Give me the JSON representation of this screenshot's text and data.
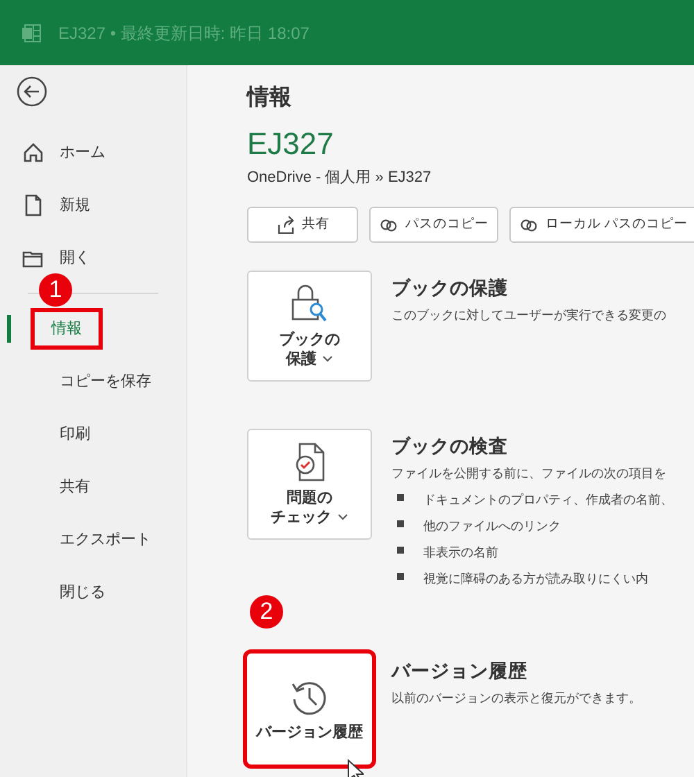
{
  "title_bar": {
    "title": "EJ327 • 最終更新日時: 昨日 18:07"
  },
  "sidebar": {
    "top_items": [
      {
        "label": "ホーム",
        "selected": false,
        "highlighted": false
      },
      {
        "label": "新規",
        "selected": false,
        "highlighted": false
      },
      {
        "label": "開く",
        "selected": false,
        "highlighted": false
      }
    ],
    "items": [
      {
        "label": "情報",
        "selected": true,
        "highlighted": true
      },
      {
        "label": "コピーを保存",
        "selected": false,
        "highlighted": false
      },
      {
        "label": "印刷",
        "selected": false,
        "highlighted": false
      },
      {
        "label": "共有",
        "selected": false,
        "highlighted": false
      },
      {
        "label": "エクスポート",
        "selected": false,
        "highlighted": false
      },
      {
        "label": "閉じる",
        "selected": false,
        "highlighted": false
      }
    ]
  },
  "annotations": [
    {
      "label": "1"
    },
    {
      "label": "2"
    }
  ],
  "page": {
    "heading": "情報",
    "file_name": "EJ327",
    "path": "OneDrive - 個人用 » EJ327",
    "actions": [
      {
        "label": "共有"
      },
      {
        "label": "パスのコピー"
      },
      {
        "label": "ローカル パスのコピー"
      }
    ],
    "sections": [
      {
        "button_lines": [
          "ブックの",
          "保護"
        ],
        "dropdown": true,
        "highlighted": false,
        "title": "ブックの保護",
        "description": "このブックに対してユーザーが実行できる変更の"
      },
      {
        "button_lines": [
          "問題の",
          "チェック"
        ],
        "dropdown": true,
        "highlighted": false,
        "title": "ブックの検査",
        "description": "ファイルを公開する前に、ファイルの次の項目を",
        "bullets": [
          "ドキュメントのプロパティ、作成者の名前、",
          "他のファイルへのリンク",
          "非表示の名前",
          "視覚に障碍のある方が読み取りにくい内"
        ]
      },
      {
        "button_lines": [
          "バージョン履歴"
        ],
        "dropdown": false,
        "highlighted": true,
        "title": "バージョン履歴",
        "description": "以前のバージョンの表示と復元ができます。"
      }
    ]
  }
}
